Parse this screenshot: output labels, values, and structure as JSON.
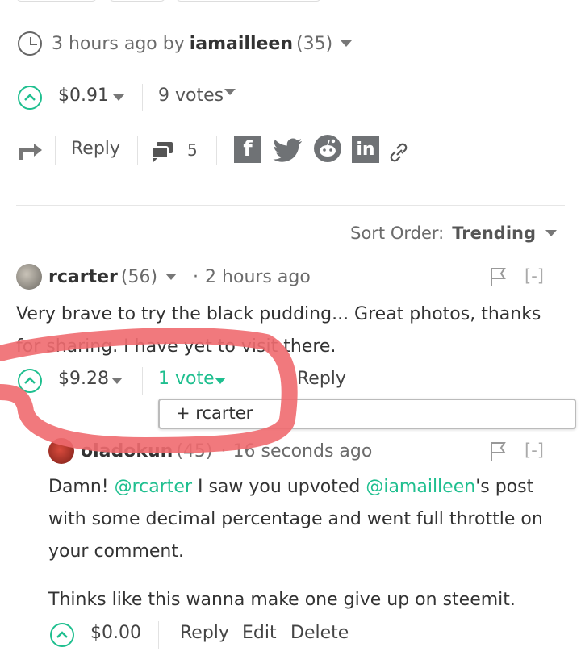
{
  "post": {
    "time": "3 hours ago by",
    "author": "iamailleen",
    "rep": "(35)",
    "payout": "$0.91",
    "votes": "9 votes",
    "reply": "Reply",
    "comments_count": "5"
  },
  "sort": {
    "label": "Sort Order:",
    "value": "Trending"
  },
  "comment1": {
    "author": "rcarter",
    "rep": "(56)",
    "time": "2 hours ago",
    "collapse": "[-]",
    "body": "Very brave to try the black pudding... Great photos, thanks for sharing. I have yet to visit there.",
    "payout": "$9.28",
    "votes": "1 vote",
    "reply": "Reply",
    "voter": "+ rcarter"
  },
  "comment2": {
    "author": "oladokun",
    "rep": "(45)",
    "time": "16 seconds ago",
    "collapse": "[-]",
    "p1_a": "Damn! ",
    "mention1": "@rcarter",
    "p1_b": " I saw you upvoted ",
    "mention2": "@iamailleen",
    "p1_c": "'s post with some decimal percentage and went full throttle on your comment.",
    "p2": "Thinks like this wanna make one give up on steemit.",
    "payout": "$0.00",
    "reply": "Reply",
    "edit": "Edit",
    "delete": "Delete"
  },
  "colors": {
    "accent": "#1fbf8f",
    "annotation": "#f06a6f"
  }
}
